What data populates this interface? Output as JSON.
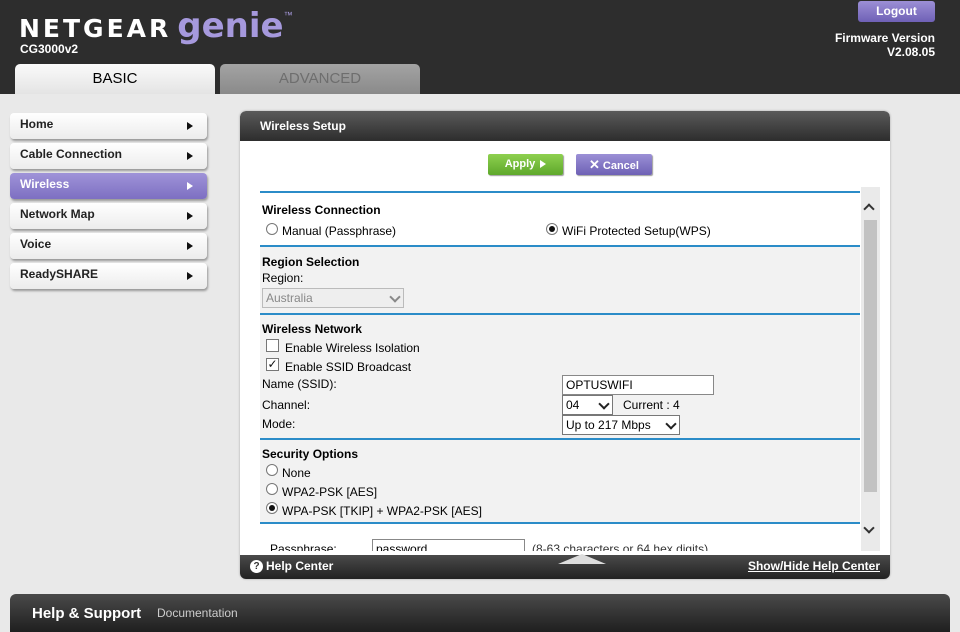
{
  "header": {
    "brand": "NETGEAR",
    "product": "genie",
    "tm": "™",
    "model": "CG3000v2",
    "logout_label": "Logout",
    "firmware_label": "Firmware Version",
    "firmware_version": "V2.08.05",
    "tabs": [
      {
        "label": "BASIC",
        "active": true
      },
      {
        "label": "ADVANCED",
        "active": false
      }
    ]
  },
  "sidebar": {
    "items": [
      {
        "label": "Home",
        "active": false
      },
      {
        "label": "Cable Connection",
        "active": false
      },
      {
        "label": "Wireless",
        "active": true
      },
      {
        "label": "Network Map",
        "active": false
      },
      {
        "label": "Voice",
        "active": false
      },
      {
        "label": "ReadySHARE",
        "active": false
      }
    ]
  },
  "panel": {
    "title": "Wireless Setup",
    "apply_label": "Apply",
    "cancel_label": "Cancel",
    "wireless_connection": {
      "heading": "Wireless Connection",
      "manual_label": "Manual (Passphrase)",
      "manual_selected": false,
      "wps_label": "WiFi Protected Setup(WPS)",
      "wps_selected": true
    },
    "region": {
      "heading": "Region Selection",
      "label": "Region:",
      "value": "Australia"
    },
    "wireless_network": {
      "heading": "Wireless Network",
      "isolation_label": "Enable Wireless Isolation",
      "isolation_checked": false,
      "ssid_broadcast_label": "Enable SSID Broadcast",
      "ssid_broadcast_checked": true,
      "ssid_label": "Name (SSID):",
      "ssid_value": "OPTUSWIFI",
      "channel_label": "Channel:",
      "channel_value": "04",
      "current_label": "Current : 4",
      "mode_label": "Mode:",
      "mode_value": "Up to 217 Mbps"
    },
    "security": {
      "heading": "Security Options",
      "options": [
        {
          "label": "None",
          "selected": false
        },
        {
          "label": "WPA2-PSK [AES]",
          "selected": false
        },
        {
          "label": "WPA-PSK [TKIP] + WPA2-PSK [AES]",
          "selected": true
        }
      ],
      "passphrase_label": "Passphrase:",
      "passphrase_value": "password",
      "passphrase_hint": "(8-63 characters or 64 hex digits)"
    },
    "footer": {
      "help_center": "Help Center",
      "show_hide": "Show/Hide Help Center"
    }
  },
  "bottom": {
    "help_support": "Help & Support",
    "documentation": "Documentation"
  },
  "colors": {
    "accent_purple": "#7d6fc2",
    "apply_green": "#6cb534",
    "divider_blue": "#2b8cc8",
    "header_dark": "#2d2d2d"
  }
}
